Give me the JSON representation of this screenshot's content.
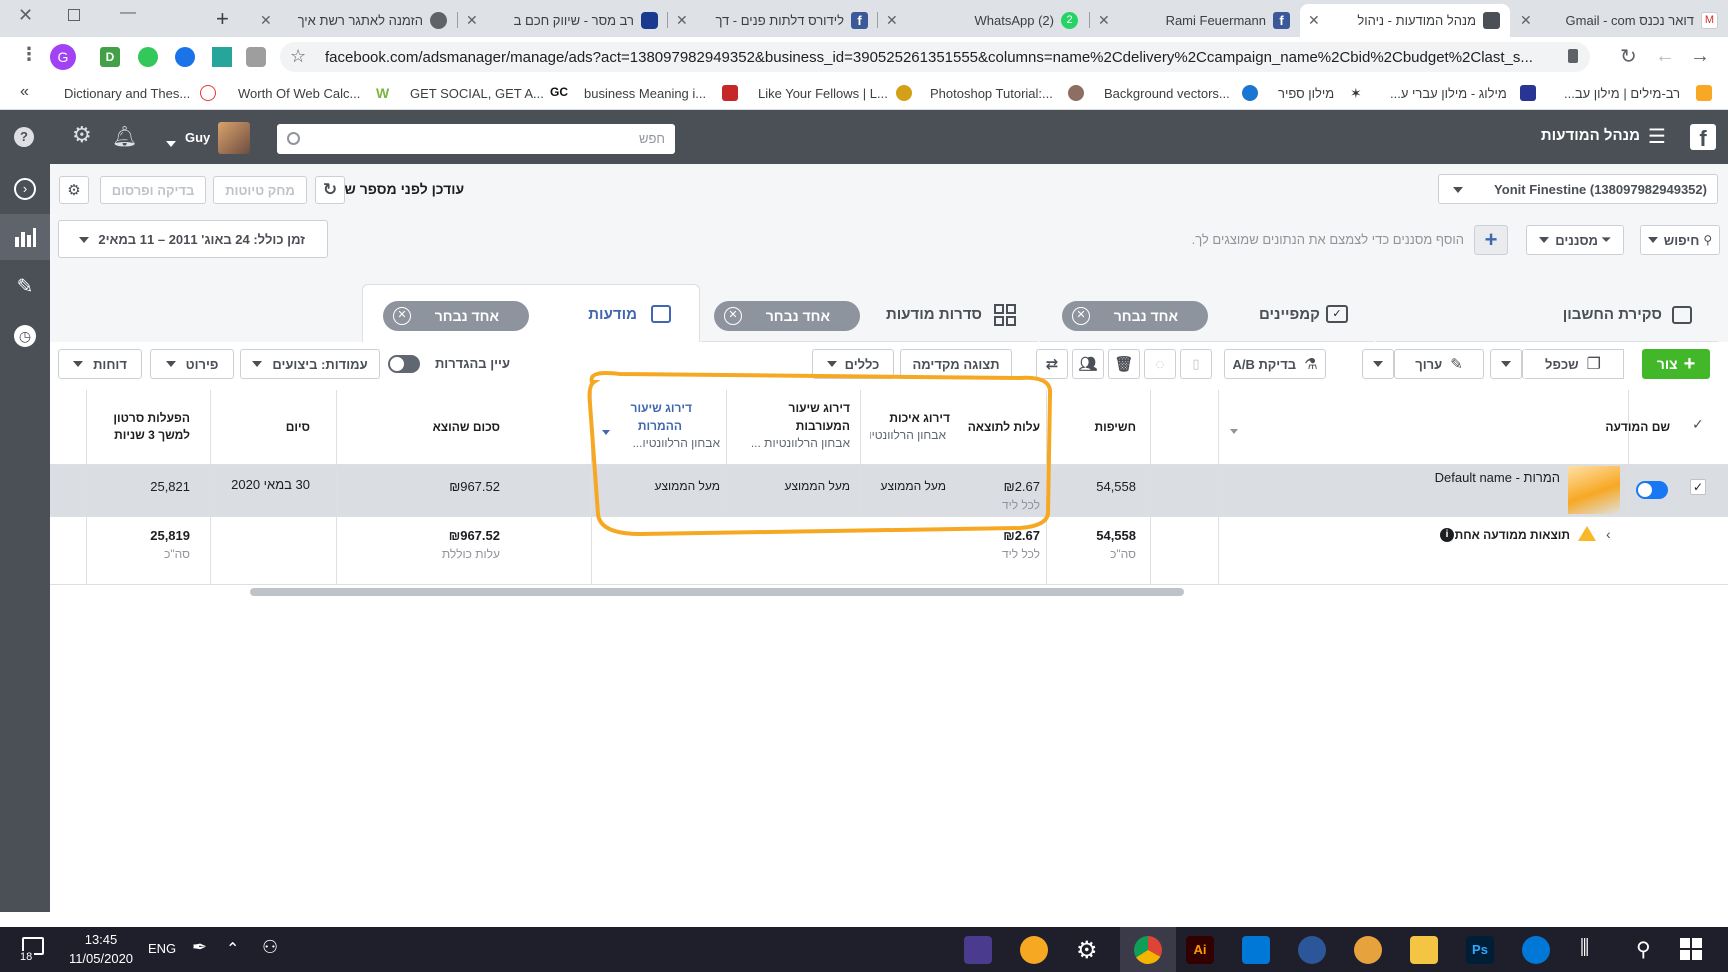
{
  "browser": {
    "tabs": [
      {
        "label": "דואר נכנס Gmail - com",
        "active": false
      },
      {
        "label": "מנהל המודעות - ניהול",
        "active": true
      },
      {
        "label": "Rami Feuermann",
        "active": false
      },
      {
        "label": "(2) WhatsApp",
        "active": false
      },
      {
        "label": "לידורס דלתות פנים - דך",
        "active": false
      },
      {
        "label": "רב מסר - שיווק חכם ב",
        "active": false
      },
      {
        "label": "הזמנה לאתגר רשת איך",
        "active": false
      }
    ],
    "url": "facebook.com/adsmanager/manage/ads?act=138097982949352&business_id=390525261351555&columns=name%2Cdelivery%2Ccampaign_name%2Cbid%2Cbudget%2Clast_s...",
    "profile_letter": "G",
    "bookmarks": [
      "רב-מילים | מילון עב...",
      "מילוג - מילון עברי ע...",
      "מילון ספיר",
      "Background vectors...",
      "Photoshop Tutorial:...",
      "Like Your Fellows | L...",
      "business Meaning i...",
      "GET SOCIAL, GET A...",
      "Worth Of Web Calc...",
      "Dictionary and Thes..."
    ],
    "bookmarks_more": "«"
  },
  "fb": {
    "app_title": "מנהל המודעות",
    "search_placeholder": "חפש",
    "user_name": "Guy"
  },
  "toolbar": {
    "account": "(Yonit Finestine (138097982949352",
    "status": "עודכן לפני מספר שניות",
    "discard_label": "מחק טיוטות",
    "review_label": "בדיקה ופרסום",
    "search_label": "חיפוש",
    "filters_label": "מסננים",
    "filter_hint": "הוסף מסננים כדי לצמצם את הנתונים שמוצגים לך.",
    "date_range": "זמן כולל: 24 באוג' 2011 – 11 במאי ",
    "date_range_end": "2"
  },
  "level_tabs": [
    {
      "label": "סקירת החשבון"
    },
    {
      "label": "קמפיינים",
      "pill": "אחד נבחר"
    },
    {
      "label": "סדרות מודעות",
      "pill": "אחד נבחר"
    },
    {
      "label": "מודעות",
      "pill": "אחד נבחר"
    }
  ],
  "actions": {
    "create": "צור",
    "duplicate": "שכפל",
    "edit": "ערוך",
    "ab_test": "בדיקת A/B",
    "preview": "תצוגה מקדימה",
    "rules": "כללים",
    "view_settings": "עיין בהגדרות",
    "columns": "עמודות: ביצועים",
    "breakdown": "פירוט",
    "reports": "דוחות"
  },
  "table": {
    "headers": {
      "name": "שם המודעה",
      "impressions": "חשיפות",
      "cost_per_result": "עלות לתוצאה",
      "quality_ranking": "דירוג איכות",
      "quality_sub": "אבחון הרלוונטיות ...",
      "engagement_ranking_1": "דירוג שיעור",
      "engagement_ranking_2": "המעורבות",
      "engagement_sub": "אבחון הרלוונטיות ...",
      "conversion_ranking_1": "דירוג שיעור",
      "conversion_ranking_2": "ההמרות",
      "conversion_sub": "אבחון הרלוונטיו...",
      "amount_spent": "סכום שהוצא",
      "ends": "סיום",
      "video_1": "הפעלות סרטון",
      "video_2": "למשך 3 שניות"
    },
    "row": {
      "name": "המרות - Default name",
      "impressions": "54,558",
      "cost_per_result": "₪2.67",
      "cost_sub": "לכל ליד",
      "quality": "מעל הממוצע",
      "engagement": "מעל הממוצע",
      "conversion": "מעל הממוצע",
      "amount_spent": "₪967.52",
      "ends": "30 במאי 2020",
      "video": "25,821"
    },
    "summary": {
      "label": "תוצאות ממודעה אחת",
      "impressions": "54,558",
      "impressions_sub": "סה\"כ",
      "cost_per_result": "₪2.67",
      "cost_sub": "לכל ליד",
      "amount_spent": "₪967.52",
      "amount_sub": "עלות כוללת",
      "video": "25,819",
      "video_sub": "סה\"כ"
    }
  },
  "taskbar": {
    "time": "13:45",
    "date": "11/05/2020",
    "lang": "ENG",
    "notifications": "18"
  },
  "colors": {
    "fb_bar": "#4b4f56",
    "highlight": "#f7a823",
    "create_green": "#42b72a",
    "link_blue": "#4267b2",
    "toggle_blue": "#1877f2"
  }
}
